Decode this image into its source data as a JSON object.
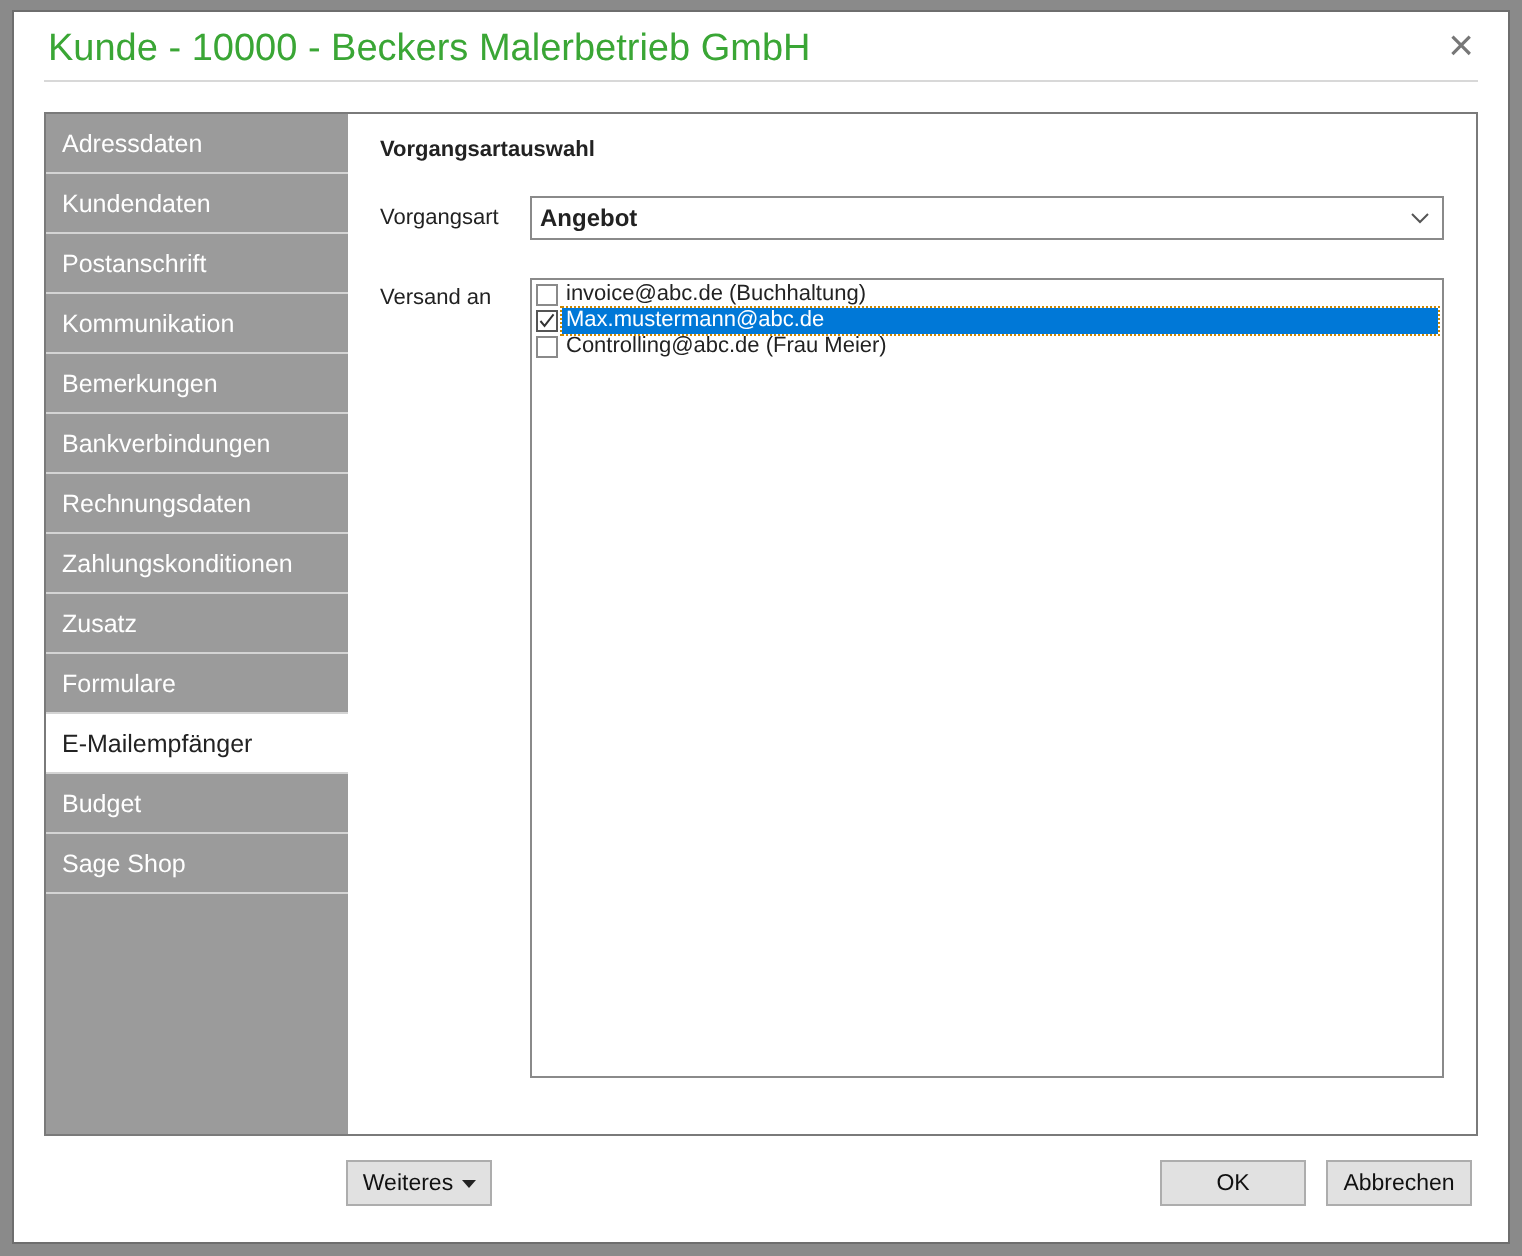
{
  "window": {
    "title": "Kunde - 10000 - Beckers Malerbetrieb GmbH",
    "close": "×"
  },
  "sidebar": {
    "items": [
      {
        "label": "Adressdaten",
        "selected": false
      },
      {
        "label": "Kundendaten",
        "selected": false
      },
      {
        "label": "Postanschrift",
        "selected": false
      },
      {
        "label": "Kommunikation",
        "selected": false
      },
      {
        "label": "Bemerkungen",
        "selected": false
      },
      {
        "label": "Bankverbindungen",
        "selected": false
      },
      {
        "label": "Rechnungsdaten",
        "selected": false
      },
      {
        "label": "Zahlungskonditionen",
        "selected": false
      },
      {
        "label": "Zusatz",
        "selected": false
      },
      {
        "label": "Formulare",
        "selected": false
      },
      {
        "label": "E-Mailempfänger",
        "selected": true
      },
      {
        "label": "Budget",
        "selected": false
      },
      {
        "label": "Sage Shop",
        "selected": false
      }
    ]
  },
  "section_title": "Vorgangsartauswahl",
  "vorgangsart": {
    "label": "Vorgangsart",
    "value": "Angebot"
  },
  "versand": {
    "label": "Versand an",
    "items": [
      {
        "label": "invoice@abc.de (Buchhaltung)",
        "checked": false,
        "selected": false
      },
      {
        "label": "Max.mustermann@abc.de",
        "checked": true,
        "selected": true
      },
      {
        "label": "Controlling@abc.de (Frau Meier)",
        "checked": false,
        "selected": false
      }
    ]
  },
  "buttons": {
    "more": "Weiteres",
    "ok": "OK",
    "cancel": "Abbrechen"
  }
}
